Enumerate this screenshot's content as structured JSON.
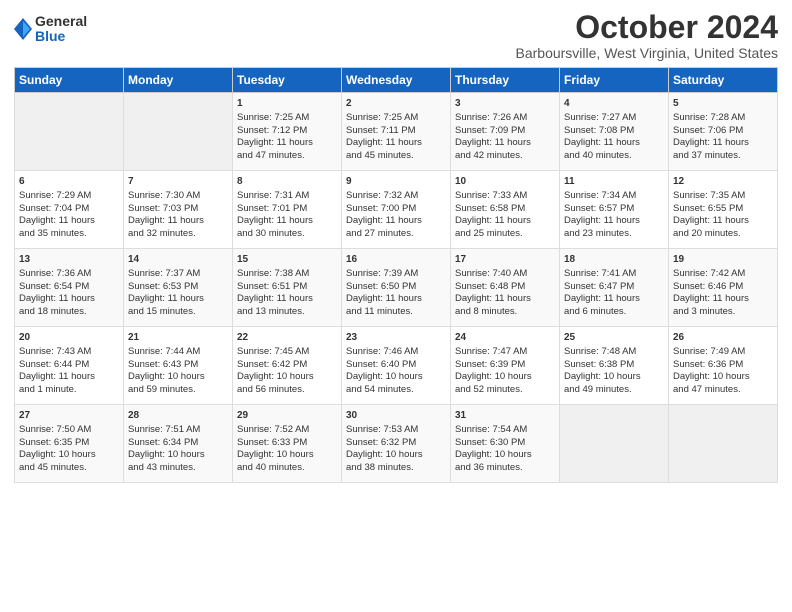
{
  "logo": {
    "general": "General",
    "blue": "Blue"
  },
  "header": {
    "title": "October 2024",
    "subtitle": "Barboursville, West Virginia, United States"
  },
  "days_of_week": [
    "Sunday",
    "Monday",
    "Tuesday",
    "Wednesday",
    "Thursday",
    "Friday",
    "Saturday"
  ],
  "weeks": [
    [
      {
        "day": "",
        "info": ""
      },
      {
        "day": "",
        "info": ""
      },
      {
        "day": "1",
        "info": "Sunrise: 7:25 AM\nSunset: 7:12 PM\nDaylight: 11 hours\nand 47 minutes."
      },
      {
        "day": "2",
        "info": "Sunrise: 7:25 AM\nSunset: 7:11 PM\nDaylight: 11 hours\nand 45 minutes."
      },
      {
        "day": "3",
        "info": "Sunrise: 7:26 AM\nSunset: 7:09 PM\nDaylight: 11 hours\nand 42 minutes."
      },
      {
        "day": "4",
        "info": "Sunrise: 7:27 AM\nSunset: 7:08 PM\nDaylight: 11 hours\nand 40 minutes."
      },
      {
        "day": "5",
        "info": "Sunrise: 7:28 AM\nSunset: 7:06 PM\nDaylight: 11 hours\nand 37 minutes."
      }
    ],
    [
      {
        "day": "6",
        "info": "Sunrise: 7:29 AM\nSunset: 7:04 PM\nDaylight: 11 hours\nand 35 minutes."
      },
      {
        "day": "7",
        "info": "Sunrise: 7:30 AM\nSunset: 7:03 PM\nDaylight: 11 hours\nand 32 minutes."
      },
      {
        "day": "8",
        "info": "Sunrise: 7:31 AM\nSunset: 7:01 PM\nDaylight: 11 hours\nand 30 minutes."
      },
      {
        "day": "9",
        "info": "Sunrise: 7:32 AM\nSunset: 7:00 PM\nDaylight: 11 hours\nand 27 minutes."
      },
      {
        "day": "10",
        "info": "Sunrise: 7:33 AM\nSunset: 6:58 PM\nDaylight: 11 hours\nand 25 minutes."
      },
      {
        "day": "11",
        "info": "Sunrise: 7:34 AM\nSunset: 6:57 PM\nDaylight: 11 hours\nand 23 minutes."
      },
      {
        "day": "12",
        "info": "Sunrise: 7:35 AM\nSunset: 6:55 PM\nDaylight: 11 hours\nand 20 minutes."
      }
    ],
    [
      {
        "day": "13",
        "info": "Sunrise: 7:36 AM\nSunset: 6:54 PM\nDaylight: 11 hours\nand 18 minutes."
      },
      {
        "day": "14",
        "info": "Sunrise: 7:37 AM\nSunset: 6:53 PM\nDaylight: 11 hours\nand 15 minutes."
      },
      {
        "day": "15",
        "info": "Sunrise: 7:38 AM\nSunset: 6:51 PM\nDaylight: 11 hours\nand 13 minutes."
      },
      {
        "day": "16",
        "info": "Sunrise: 7:39 AM\nSunset: 6:50 PM\nDaylight: 11 hours\nand 11 minutes."
      },
      {
        "day": "17",
        "info": "Sunrise: 7:40 AM\nSunset: 6:48 PM\nDaylight: 11 hours\nand 8 minutes."
      },
      {
        "day": "18",
        "info": "Sunrise: 7:41 AM\nSunset: 6:47 PM\nDaylight: 11 hours\nand 6 minutes."
      },
      {
        "day": "19",
        "info": "Sunrise: 7:42 AM\nSunset: 6:46 PM\nDaylight: 11 hours\nand 3 minutes."
      }
    ],
    [
      {
        "day": "20",
        "info": "Sunrise: 7:43 AM\nSunset: 6:44 PM\nDaylight: 11 hours\nand 1 minute."
      },
      {
        "day": "21",
        "info": "Sunrise: 7:44 AM\nSunset: 6:43 PM\nDaylight: 10 hours\nand 59 minutes."
      },
      {
        "day": "22",
        "info": "Sunrise: 7:45 AM\nSunset: 6:42 PM\nDaylight: 10 hours\nand 56 minutes."
      },
      {
        "day": "23",
        "info": "Sunrise: 7:46 AM\nSunset: 6:40 PM\nDaylight: 10 hours\nand 54 minutes."
      },
      {
        "day": "24",
        "info": "Sunrise: 7:47 AM\nSunset: 6:39 PM\nDaylight: 10 hours\nand 52 minutes."
      },
      {
        "day": "25",
        "info": "Sunrise: 7:48 AM\nSunset: 6:38 PM\nDaylight: 10 hours\nand 49 minutes."
      },
      {
        "day": "26",
        "info": "Sunrise: 7:49 AM\nSunset: 6:36 PM\nDaylight: 10 hours\nand 47 minutes."
      }
    ],
    [
      {
        "day": "27",
        "info": "Sunrise: 7:50 AM\nSunset: 6:35 PM\nDaylight: 10 hours\nand 45 minutes."
      },
      {
        "day": "28",
        "info": "Sunrise: 7:51 AM\nSunset: 6:34 PM\nDaylight: 10 hours\nand 43 minutes."
      },
      {
        "day": "29",
        "info": "Sunrise: 7:52 AM\nSunset: 6:33 PM\nDaylight: 10 hours\nand 40 minutes."
      },
      {
        "day": "30",
        "info": "Sunrise: 7:53 AM\nSunset: 6:32 PM\nDaylight: 10 hours\nand 38 minutes."
      },
      {
        "day": "31",
        "info": "Sunrise: 7:54 AM\nSunset: 6:30 PM\nDaylight: 10 hours\nand 36 minutes."
      },
      {
        "day": "",
        "info": ""
      },
      {
        "day": "",
        "info": ""
      }
    ]
  ]
}
